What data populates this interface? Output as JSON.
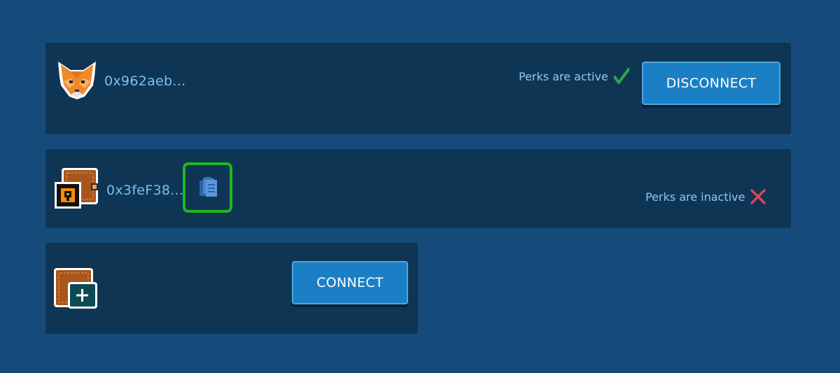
{
  "wallets": [
    {
      "icon": "metamask-fox-icon",
      "address": "0x962aeb...",
      "perks_text": "Perks are active",
      "perks_status": "active",
      "button_label": "DISCONNECT"
    },
    {
      "icon": "wallet-icon",
      "address": "0x3feF38...",
      "copy_icon": "copy-icon",
      "perks_text": "Perks are inactive",
      "perks_status": "inactive"
    },
    {
      "icon": "add-wallet-icon",
      "button_label": "CONNECT"
    }
  ],
  "colors": {
    "background": "#154b7a",
    "panel": "#0f3555",
    "button": "#1a7fc4",
    "address_text": "#79c1ea",
    "check_green": "#2ea84a",
    "cross_red": "#e0405a",
    "highlight_green": "#1db81d"
  }
}
